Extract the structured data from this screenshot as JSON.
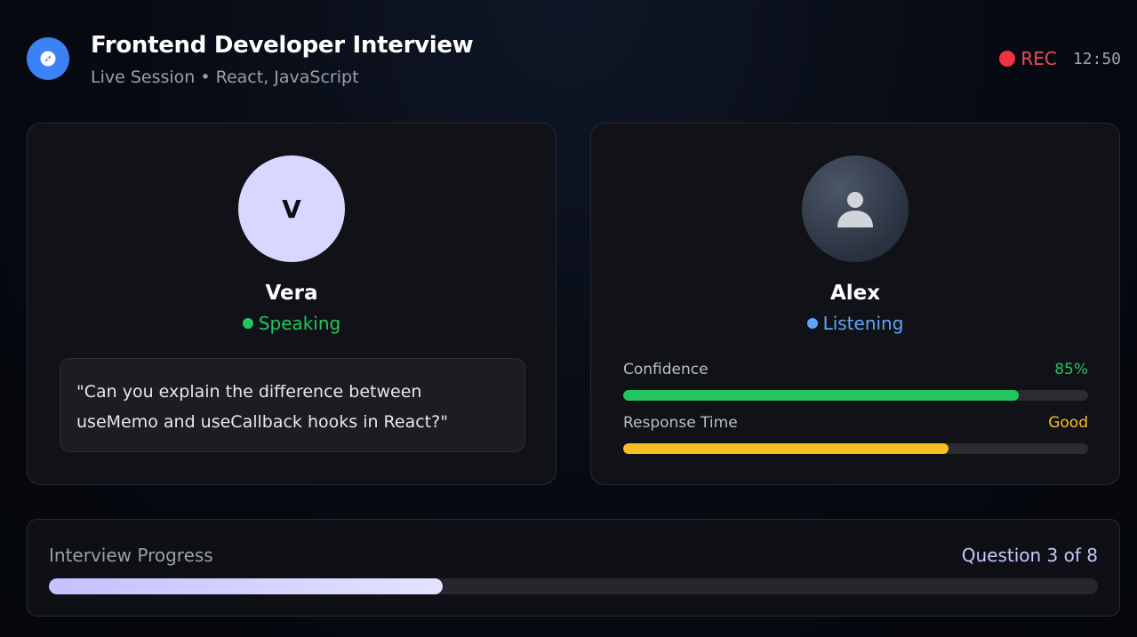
{
  "header": {
    "title": "Frontend Developer Interview",
    "subtitle": "Live Session • React, JavaScript",
    "logo_icon": "compass-icon",
    "recording": {
      "label": "REC",
      "timer": "12:50",
      "color": "#ef3340"
    }
  },
  "interviewer": {
    "initial": "V",
    "name": "Vera",
    "status": "Speaking",
    "status_color": "#22c55e",
    "avatar_color": "#d9d6ff",
    "quote": "\"Can you explain the difference between useMemo and useCallback hooks in React?\""
  },
  "candidate": {
    "name": "Alex",
    "avatar_icon": "user-icon",
    "status": "Listening",
    "status_color": "#60a5fa",
    "metrics": {
      "confidence": {
        "label": "Confidence",
        "value": "85%",
        "fraction": 0.85,
        "color": "#22c55e"
      },
      "response_time": {
        "label": "Response Time",
        "value": "Good",
        "fraction": 0.7,
        "color": "#fbbf24"
      }
    }
  },
  "progress": {
    "label": "Interview Progress",
    "count": "Question 3 of 8",
    "current": 3,
    "total": 8
  }
}
